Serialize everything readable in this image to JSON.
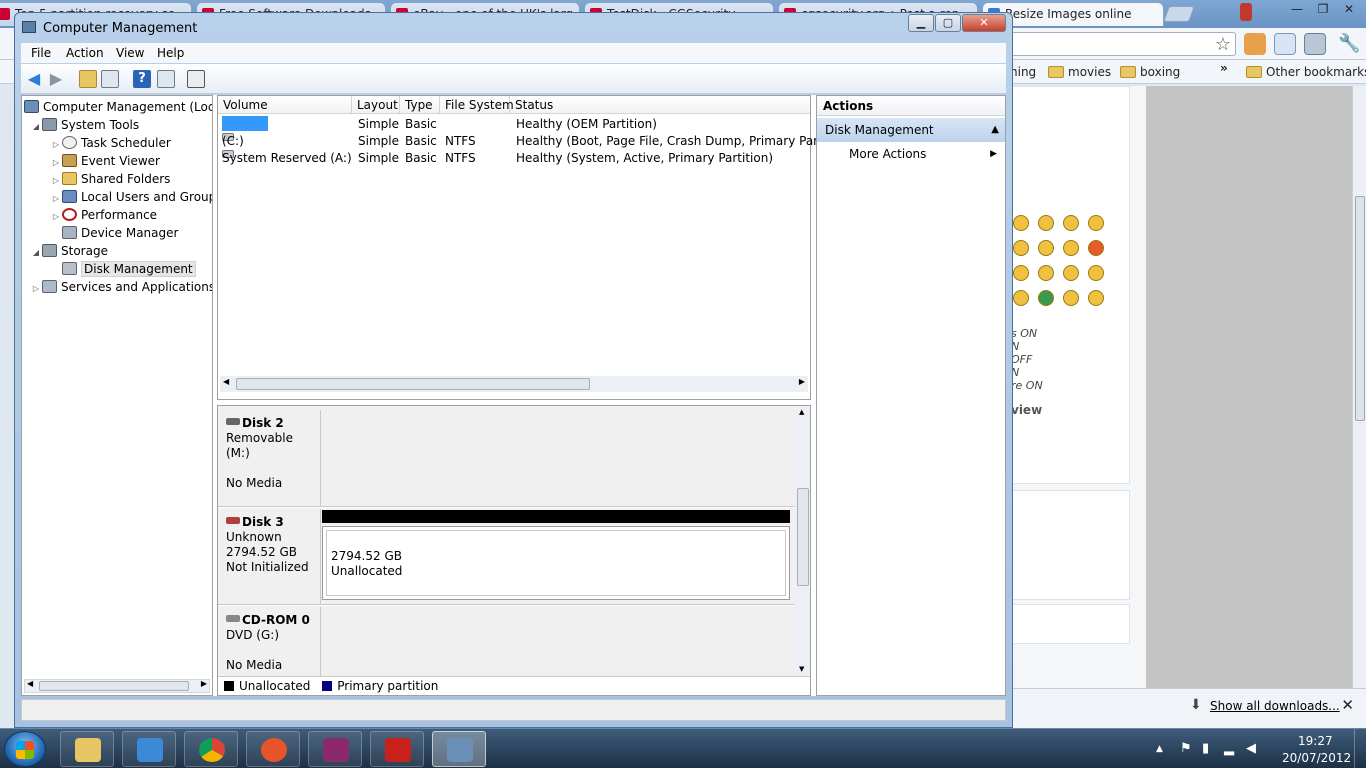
{
  "browser": {
    "tabs": [
      {
        "label": "Top 5 partition recovery so"
      },
      {
        "label": "Free Software Downloads"
      },
      {
        "label": "eBay - one of the UK's larg"
      },
      {
        "label": "TestDisk - CGSecurity"
      },
      {
        "label": "cgsecurity.org • Post a rep"
      },
      {
        "label": "Resize Images online"
      }
    ],
    "bookmarks": {
      "partial": "ning",
      "movies": "movies",
      "boxing": "boxing",
      "more": "»",
      "other": "Other bookmarks"
    },
    "content_fragments": [
      "s ON",
      "N",
      "OFF",
      "N",
      "re ON",
      "view"
    ],
    "downloads": {
      "show_all": "Show all downloads..."
    }
  },
  "window": {
    "title": "Computer Management",
    "menus": [
      "File",
      "Action",
      "View",
      "Help"
    ]
  },
  "tree": {
    "items": [
      {
        "label": "Computer Management (Local",
        "icon": "computer-management-icon"
      },
      {
        "label": "System Tools",
        "icon": "system-tools-icon"
      },
      {
        "label": "Task Scheduler",
        "icon": "clock-icon"
      },
      {
        "label": "Event Viewer",
        "icon": "event-viewer-icon"
      },
      {
        "label": "Shared Folders",
        "icon": "shared-folder-icon"
      },
      {
        "label": "Local Users and Groups",
        "icon": "users-icon"
      },
      {
        "label": "Performance",
        "icon": "performance-icon"
      },
      {
        "label": "Device Manager",
        "icon": "device-manager-icon"
      },
      {
        "label": "Storage",
        "icon": "storage-icon"
      },
      {
        "label": "Disk Management",
        "icon": "disk-management-icon"
      },
      {
        "label": "Services and Applications",
        "icon": "services-icon"
      }
    ]
  },
  "volumes": {
    "columns": [
      "Volume",
      "Layout",
      "Type",
      "File System",
      "Status"
    ],
    "rows": [
      {
        "volume": "",
        "layout": "Simple",
        "type": "Basic",
        "fs": "",
        "status": "Healthy (OEM Partition)"
      },
      {
        "volume": "(C:)",
        "layout": "Simple",
        "type": "Basic",
        "fs": "NTFS",
        "status": "Healthy (Boot, Page File, Crash Dump, Primary Partition)"
      },
      {
        "volume": "System Reserved (A:)",
        "layout": "Simple",
        "type": "Basic",
        "fs": "NTFS",
        "status": "Healthy (System, Active, Primary Partition)"
      }
    ]
  },
  "disks": [
    {
      "name": "Disk 2",
      "line1": "Removable (M:)",
      "line2": "",
      "line3": "No Media"
    },
    {
      "name": "Disk 3",
      "line1": "Unknown",
      "line2": "2794.52 GB",
      "line3": "Not Initialized",
      "partition": {
        "size": "2794.52 GB",
        "label": "Unallocated"
      }
    },
    {
      "name": "CD-ROM 0",
      "line1": "DVD (G:)",
      "line2": "",
      "line3": "No Media"
    }
  ],
  "legend": [
    {
      "label": "Unallocated",
      "color": "#000000"
    },
    {
      "label": "Primary partition",
      "color": "#000080"
    }
  ],
  "actions": {
    "header": "Actions",
    "section": "Disk Management",
    "more": "More Actions"
  },
  "clock": {
    "time": "19:27",
    "date": "20/07/2012"
  },
  "colors": {
    "selection": "#3399ff",
    "unallocated": "#000000",
    "primary": "#000080"
  }
}
